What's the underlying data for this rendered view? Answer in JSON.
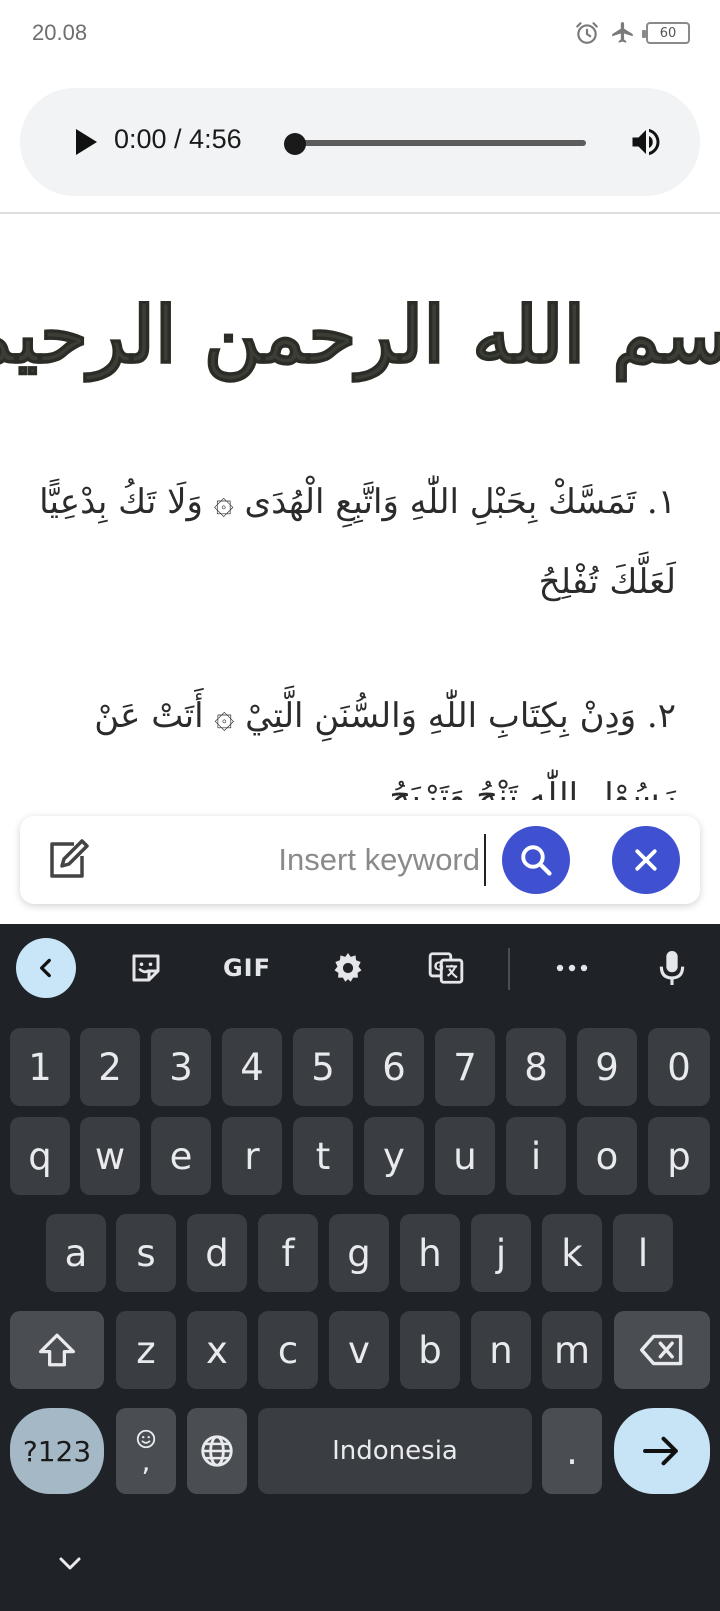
{
  "status_bar": {
    "time": "20.08",
    "battery": "60",
    "icons": [
      "alarm-icon",
      "airplane-icon",
      "battery-icon"
    ]
  },
  "player": {
    "time": "0:00 / 4:56",
    "progress": 0,
    "icons": [
      "play-icon",
      "volume-icon"
    ]
  },
  "content": {
    "basmala": "بسم الله الرحمن الرحيم",
    "verses": [
      {
        "text": "١. تَمَسَّكْ بِحَبْلِ اللّٰهِ وَاتَّبِعِ الْهُدَى ۞ وَلَا تَكُ بِدْعِيًّا لَعَلَّكَ تُفْلِحُ"
      },
      {
        "text": "٢. وَدِنْ بِكِتَابِ اللّٰهِ وَالسُّنَنِ الَّتِيْ ۞ أَتَتْ عَنْ رَسُوْلِ اللّٰهِ تَنْجُ وَتَرْبَحُ"
      }
    ]
  },
  "search": {
    "placeholder": "Insert keyword",
    "value": "",
    "accent_color": "#3f51d0",
    "icons": [
      "edit-icon",
      "search-icon",
      "close-icon"
    ]
  },
  "keyboard": {
    "toolbar_gif": "GIF",
    "toolbar_icons": [
      "chevron-left-icon",
      "sticker-icon",
      "gif-icon",
      "settings-icon",
      "translate-icon",
      "more-icon",
      "mic-icon"
    ],
    "row_numbers": [
      "1",
      "2",
      "3",
      "4",
      "5",
      "6",
      "7",
      "8",
      "9",
      "0"
    ],
    "row_1": [
      "q",
      "w",
      "e",
      "r",
      "t",
      "y",
      "u",
      "i",
      "o",
      "p"
    ],
    "row_2": [
      "a",
      "s",
      "d",
      "f",
      "g",
      "h",
      "j",
      "k",
      "l"
    ],
    "row_3": [
      "z",
      "x",
      "c",
      "v",
      "b",
      "n",
      "m"
    ],
    "symbols_label": "?123",
    "comma_label": ",",
    "space_label": "Indonesia",
    "period_label": ".",
    "colors": {
      "background": "#1f2226",
      "key": "#3a3d41",
      "action_key": "#c7e3f6"
    }
  }
}
